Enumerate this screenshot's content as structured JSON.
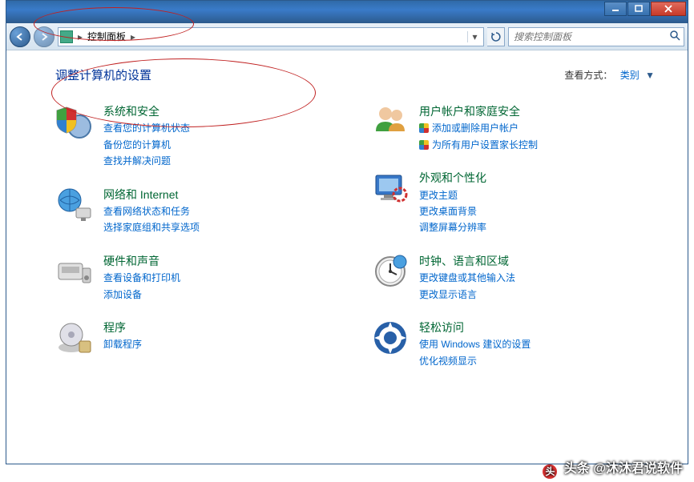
{
  "breadcrumb": {
    "root": "控制面板"
  },
  "search": {
    "placeholder": "搜索控制面板"
  },
  "page_title": "调整计算机的设置",
  "view_by": {
    "label": "查看方式：",
    "value": "类别"
  },
  "left": [
    {
      "id": "system-security",
      "title": "系统和安全",
      "links": [
        {
          "t": "查看您的计算机状态"
        },
        {
          "t": "备份您的计算机"
        },
        {
          "t": "查找并解决问题"
        }
      ]
    },
    {
      "id": "network-internet",
      "title": "网络和 Internet",
      "links": [
        {
          "t": "查看网络状态和任务"
        },
        {
          "t": "选择家庭组和共享选项"
        }
      ]
    },
    {
      "id": "hardware-sound",
      "title": "硬件和声音",
      "links": [
        {
          "t": "查看设备和打印机"
        },
        {
          "t": "添加设备"
        }
      ]
    },
    {
      "id": "programs",
      "title": "程序",
      "links": [
        {
          "t": "卸载程序"
        }
      ]
    }
  ],
  "right": [
    {
      "id": "user-accounts",
      "title": "用户帐户和家庭安全",
      "links": [
        {
          "t": "添加或删除用户帐户",
          "shield": true
        },
        {
          "t": "为所有用户设置家长控制",
          "shield": true
        }
      ]
    },
    {
      "id": "appearance",
      "title": "外观和个性化",
      "links": [
        {
          "t": "更改主题"
        },
        {
          "t": "更改桌面背景"
        },
        {
          "t": "调整屏幕分辨率"
        }
      ]
    },
    {
      "id": "clock-lang",
      "title": "时钟、语言和区域",
      "links": [
        {
          "t": "更改键盘或其他输入法"
        },
        {
          "t": "更改显示语言"
        }
      ]
    },
    {
      "id": "ease-access",
      "title": "轻松访问",
      "links": [
        {
          "t": "使用 Windows 建议的设置"
        },
        {
          "t": "优化视频显示"
        }
      ]
    }
  ],
  "watermark": {
    "prefix": "头条",
    "handle": "@沐沐君说软件"
  }
}
